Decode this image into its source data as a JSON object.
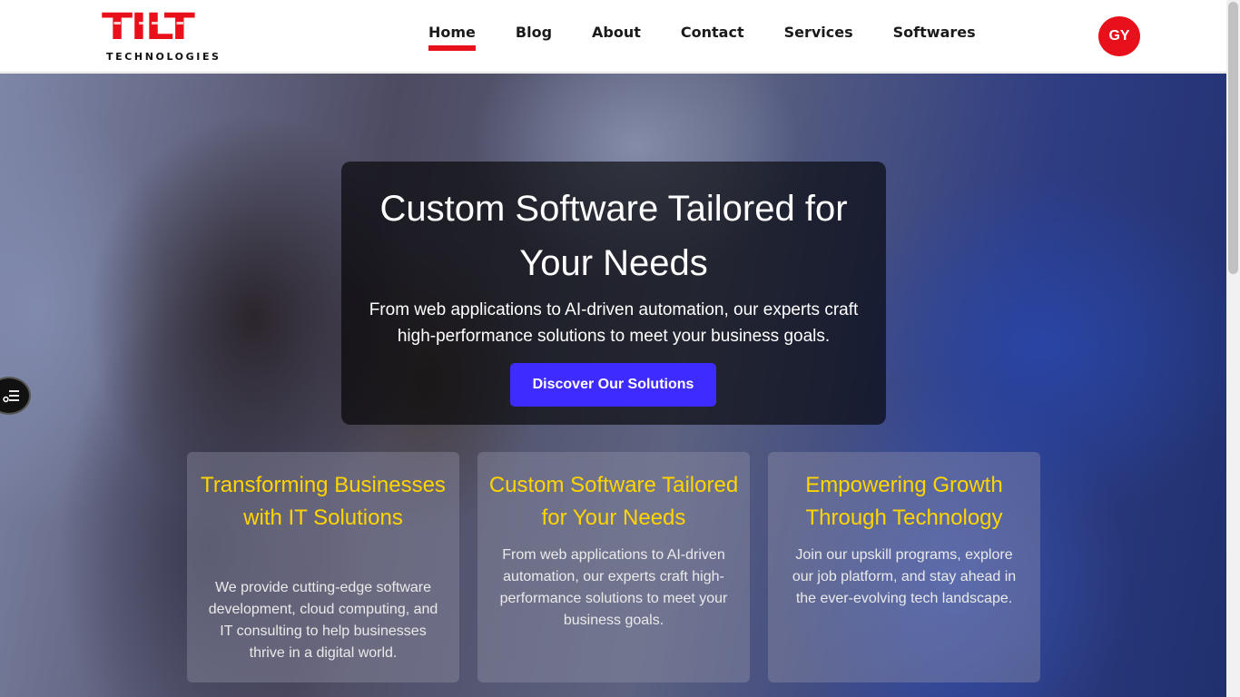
{
  "brand": {
    "logo_text": "TILT",
    "logo_subtitle": "TECHNOLOGIES",
    "accent": "#e8101a"
  },
  "nav": {
    "items": [
      {
        "label": "Home",
        "active": true
      },
      {
        "label": "Blog"
      },
      {
        "label": "About"
      },
      {
        "label": "Contact"
      },
      {
        "label": "Services"
      },
      {
        "label": "Softwares"
      }
    ]
  },
  "user": {
    "initials": "GY",
    "color": "#e8101a"
  },
  "hero": {
    "title": "Custom Software Tailored for Your Needs",
    "subtitle": "From web applications to AI-driven automation, our experts craft high-performance solutions to meet your business goals.",
    "cta_label": "Discover Our Solutions",
    "cta_color": "#3e2bff"
  },
  "features": [
    {
      "title": "Transforming Businesses with IT Solutions",
      "text": "We provide cutting-edge software development, cloud computing, and IT consulting to help businesses thrive in a digital world."
    },
    {
      "title": "Custom Software Tailored for Your Needs",
      "text": "From web applications to AI-driven automation, our experts craft high-performance solutions to meet your business goals."
    },
    {
      "title": "Empowering Growth Through Technology",
      "text": "Join our upskill programs, explore our job platform, and stay ahead in the ever-evolving tech landscape."
    }
  ],
  "icons": {
    "side_toggle": "filter-list-icon"
  }
}
